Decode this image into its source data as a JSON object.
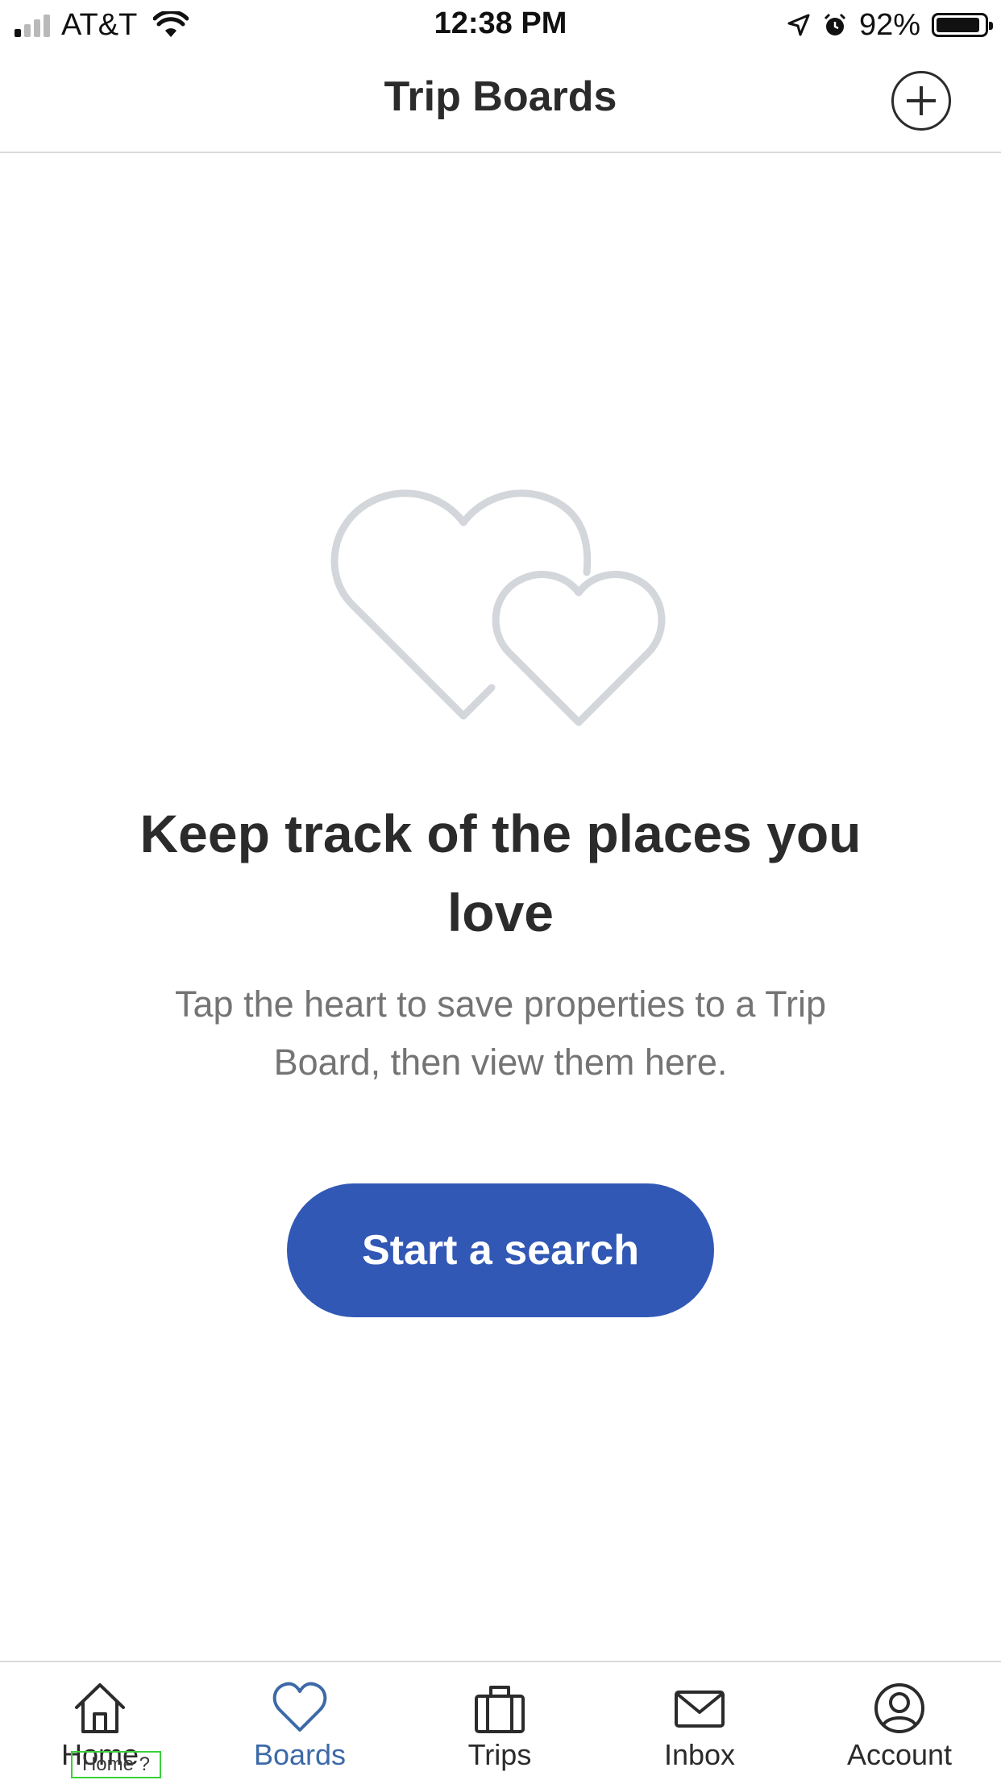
{
  "status_bar": {
    "carrier": "AT&T",
    "time": "12:38 PM",
    "battery": "92%"
  },
  "header": {
    "title": "Trip Boards",
    "add_icon": "plus-circle-icon"
  },
  "empty_state": {
    "illustration": "two-hearts-icon",
    "title": "Keep track of the places you love",
    "subtitle": "Tap the heart to save properties to a Trip Board, then view them here.",
    "button_label": "Start a search"
  },
  "tab_bar": {
    "items": [
      {
        "label": "Home",
        "icon": "home-icon",
        "active": false
      },
      {
        "label": "Boards",
        "icon": "heart-icon",
        "active": true
      },
      {
        "label": "Trips",
        "icon": "suitcase-icon",
        "active": false
      },
      {
        "label": "Inbox",
        "icon": "envelope-icon",
        "active": false
      },
      {
        "label": "Account",
        "icon": "account-icon",
        "active": false
      }
    ]
  },
  "hint": "Home ?",
  "colors": {
    "accent": "#3258b5",
    "active_tab": "#3c6aa8",
    "illustration": "#d3d6da"
  }
}
